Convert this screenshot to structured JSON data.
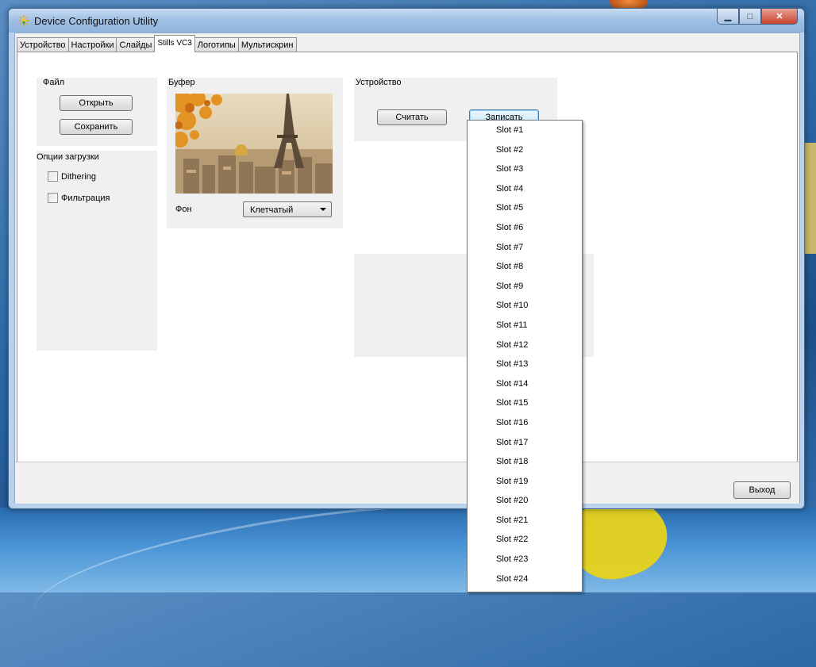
{
  "window": {
    "title": "Device Configuration Utility"
  },
  "tabs": [
    {
      "label": "Устройство"
    },
    {
      "label": "Настройки"
    },
    {
      "label": "Слайды"
    },
    {
      "label": "Stills VC3"
    },
    {
      "label": "Логотипы"
    },
    {
      "label": "Мультискрин"
    }
  ],
  "active_tab": "Stills VC3",
  "file_group": {
    "title": "Файл",
    "open_label": "Открыть",
    "save_label": "Сохранить"
  },
  "load_options": {
    "title": "Опции загрузки",
    "dithering_label": "Dithering",
    "filter_label": "Фильтрация",
    "dithering_checked": false,
    "filter_checked": false
  },
  "buffer_group": {
    "title": "Буфер",
    "background_label": "Фон",
    "background_value": "Клетчатый"
  },
  "device_group": {
    "title": "Устройство",
    "read_label": "Считать",
    "write_label": "Записать"
  },
  "slot_menu": {
    "items": [
      "Slot #1",
      "Slot #2",
      "Slot #3",
      "Slot #4",
      "Slot #5",
      "Slot #6",
      "Slot #7",
      "Slot #8",
      "Slot #9",
      "Slot #10",
      "Slot #11",
      "Slot #12",
      "Slot #13",
      "Slot #14",
      "Slot #15",
      "Slot #16",
      "Slot #17",
      "Slot #18",
      "Slot #19",
      "Slot #20",
      "Slot #21",
      "Slot #22",
      "Slot #23",
      "Slot #24"
    ]
  },
  "footer": {
    "exit_label": "Выход"
  },
  "colors": {
    "title_bar": "#9fbfe3",
    "close_button": "#c7432e",
    "focus_border": "#3c7fb1"
  }
}
